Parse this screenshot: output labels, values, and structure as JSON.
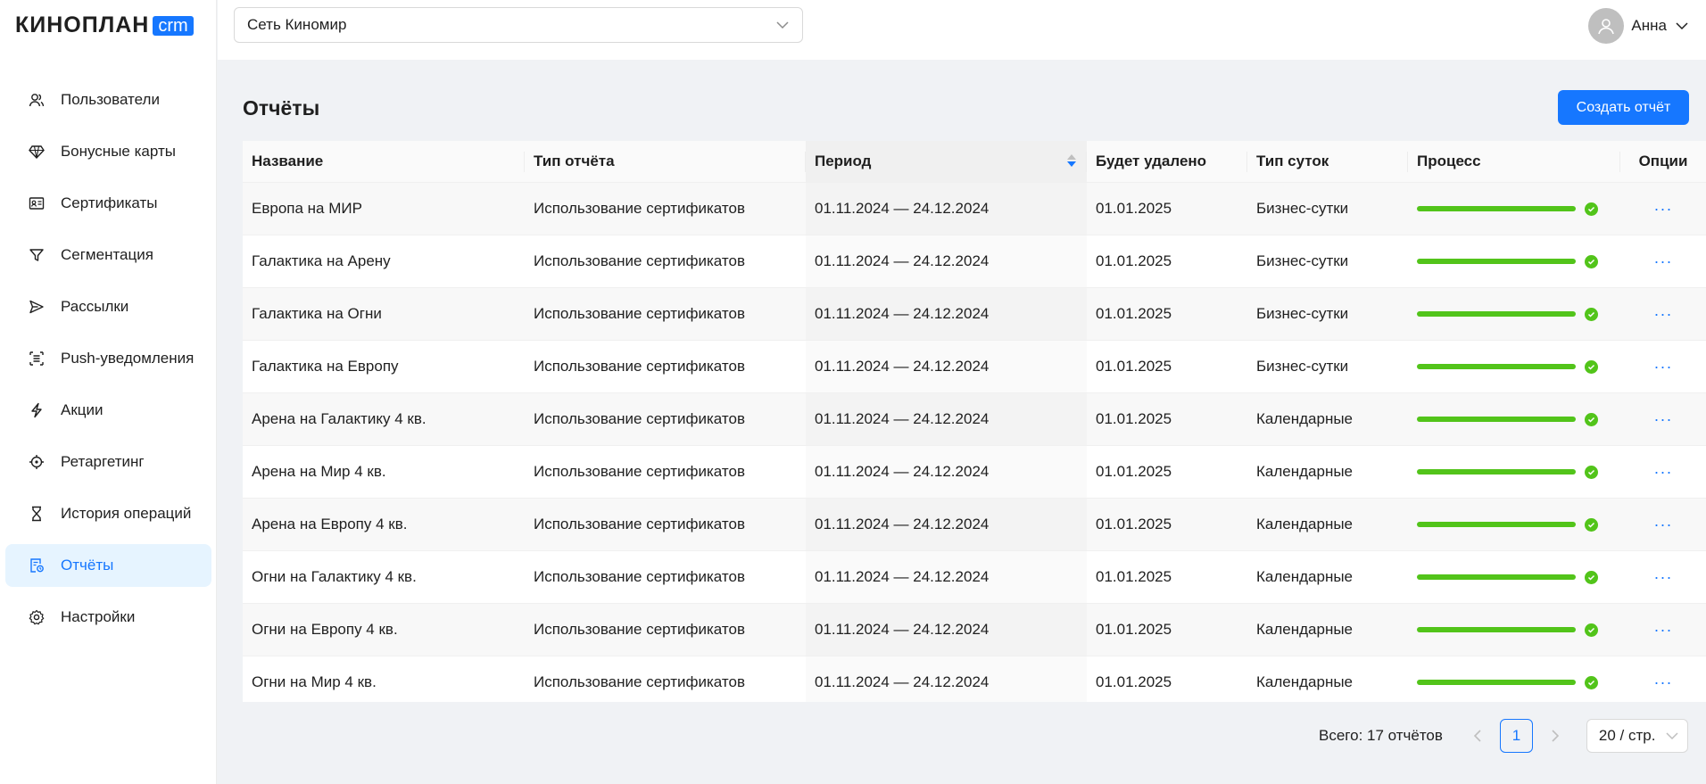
{
  "logo": {
    "main": "КИНОПЛАН",
    "badge": "crm"
  },
  "sidebar": {
    "items": [
      {
        "label": "Пользователи",
        "icon": "users-icon"
      },
      {
        "label": "Бонусные карты",
        "icon": "diamond-icon"
      },
      {
        "label": "Сертификаты",
        "icon": "certificate-icon"
      },
      {
        "label": "Сегментация",
        "icon": "filter-icon"
      },
      {
        "label": "Рассылки",
        "icon": "send-icon"
      },
      {
        "label": "Push-уведомления",
        "icon": "push-icon"
      },
      {
        "label": "Акции",
        "icon": "lightning-icon"
      },
      {
        "label": "Ретаргетинг",
        "icon": "target-icon"
      },
      {
        "label": "История операций",
        "icon": "hourglass-icon"
      },
      {
        "label": "Отчёты",
        "icon": "report-icon",
        "active": true
      },
      {
        "label": "Настройки",
        "icon": "gear-icon"
      }
    ]
  },
  "header": {
    "network": "Сеть Киномир",
    "user_name": "Анна"
  },
  "page": {
    "title": "Отчёты",
    "create_button": "Создать отчёт"
  },
  "table": {
    "columns": {
      "name": "Название",
      "type": "Тип отчёта",
      "period": "Период",
      "delete_at": "Будет удалено",
      "day_type": "Тип суток",
      "process": "Процесс",
      "options": "Опции"
    },
    "options_label": "···",
    "rows": [
      {
        "name": "Европа на МИР",
        "type": "Использование сертификатов",
        "period": "01.11.2024 — 24.12.2024",
        "delete_at": "01.01.2025",
        "day_type": "Бизнес-сутки",
        "progress": 100
      },
      {
        "name": "Галактика на Арену",
        "type": "Использование сертификатов",
        "period": "01.11.2024 — 24.12.2024",
        "delete_at": "01.01.2025",
        "day_type": "Бизнес-сутки",
        "progress": 100
      },
      {
        "name": "Галактика на Огни",
        "type": "Использование сертификатов",
        "period": "01.11.2024 — 24.12.2024",
        "delete_at": "01.01.2025",
        "day_type": "Бизнес-сутки",
        "progress": 100
      },
      {
        "name": "Галактика на Европу",
        "type": "Использование сертификатов",
        "period": "01.11.2024 — 24.12.2024",
        "delete_at": "01.01.2025",
        "day_type": "Бизнес-сутки",
        "progress": 100
      },
      {
        "name": "Арена на Галактику 4 кв.",
        "type": "Использование сертификатов",
        "period": "01.11.2024 — 24.12.2024",
        "delete_at": "01.01.2025",
        "day_type": "Календарные",
        "progress": 100
      },
      {
        "name": "Арена на Мир 4 кв.",
        "type": "Использование сертификатов",
        "period": "01.11.2024 — 24.12.2024",
        "delete_at": "01.01.2025",
        "day_type": "Календарные",
        "progress": 100
      },
      {
        "name": "Арена на Европу 4 кв.",
        "type": "Использование сертификатов",
        "period": "01.11.2024 — 24.12.2024",
        "delete_at": "01.01.2025",
        "day_type": "Календарные",
        "progress": 100
      },
      {
        "name": "Огни на Галактику 4 кв.",
        "type": "Использование сертификатов",
        "period": "01.11.2024 — 24.12.2024",
        "delete_at": "01.01.2025",
        "day_type": "Календарные",
        "progress": 100
      },
      {
        "name": "Огни на Европу 4 кв.",
        "type": "Использование сертификатов",
        "period": "01.11.2024 — 24.12.2024",
        "delete_at": "01.01.2025",
        "day_type": "Календарные",
        "progress": 100
      },
      {
        "name": "Огни на Мир 4 кв.",
        "type": "Использование сертификатов",
        "period": "01.11.2024 — 24.12.2024",
        "delete_at": "01.01.2025",
        "day_type": "Календарные",
        "progress": 100
      }
    ]
  },
  "pagination": {
    "total": "Всего: 17 отчётов",
    "current_page": "1",
    "page_size": "20 / стр."
  },
  "colors": {
    "accent": "#1677ff",
    "success": "#52c41a",
    "active_bg": "#e6f4ff"
  }
}
